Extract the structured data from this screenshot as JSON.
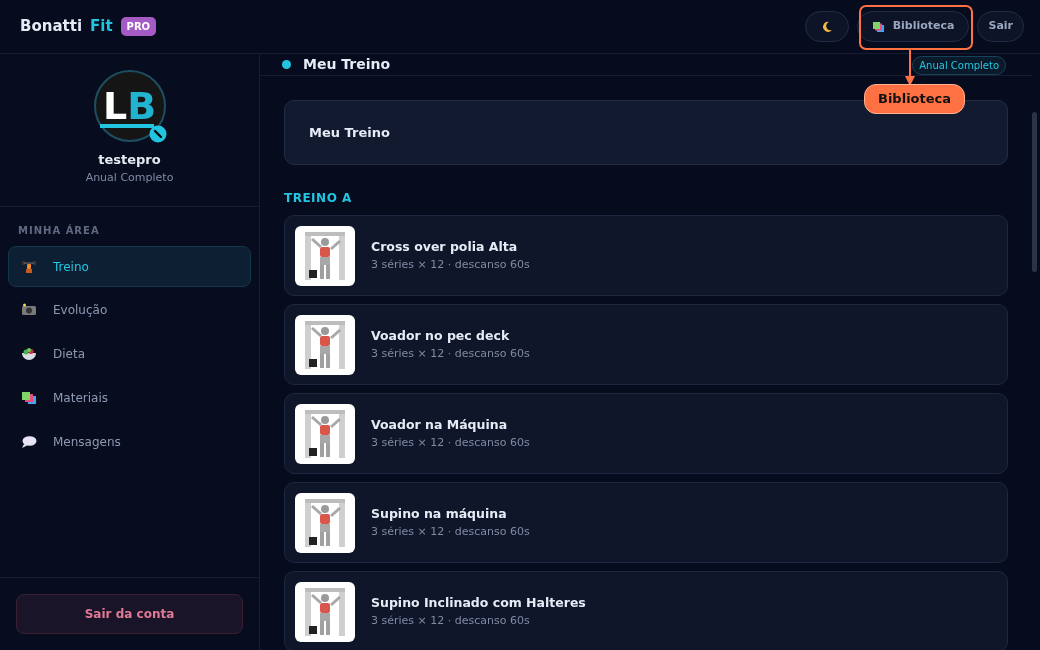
{
  "header": {
    "brand": "Bonatti",
    "brand_accent": "Fit",
    "badge": "PRO",
    "buttons": [
      {
        "kind": "theme"
      },
      {
        "kind": "library",
        "label": "Biblioteca"
      },
      {
        "kind": "logout",
        "label": "Sair"
      }
    ]
  },
  "callout": {
    "label": "Biblioteca"
  },
  "profile": {
    "avatar": {
      "first": "L",
      "second": "B"
    },
    "name": "testepro",
    "plan": "Anual Completo"
  },
  "sidebar": {
    "section": "MINHA ÁREA",
    "items": [
      {
        "kind": "dumbbell",
        "label": "Treino",
        "selected": true
      },
      {
        "kind": "camera",
        "label": "Evolução",
        "selected": false
      },
      {
        "kind": "salad",
        "label": "Dieta",
        "selected": false
      },
      {
        "kind": "materials",
        "label": "Materiais",
        "selected": false
      },
      {
        "kind": "chat",
        "label": "Mensagens",
        "selected": false
      }
    ],
    "logout": "Sair da conta"
  },
  "main": {
    "title": "Meu Treino",
    "plan_badge": "Anual Completo",
    "card_title": "Meu Treino",
    "section": "TREINO A",
    "exercises": [
      {
        "name": "Cross over polia Alta",
        "detail": "3 séries × 12 · descanso 60s",
        "kind": "picture"
      },
      {
        "name": "Voador no pec deck",
        "detail": "3 séries × 12 · descanso 60s",
        "kind": "picture"
      },
      {
        "name": "Voador na Máquina",
        "detail": "3 séries × 12 · descanso 60s",
        "kind": "picture"
      },
      {
        "name": "Supino na máquina",
        "detail": "3 séries × 12 · descanso 60s",
        "kind": "picture"
      },
      {
        "name": "Supino Inclinado com Halteres",
        "detail": "3 séries × 12 · descanso 60s",
        "kind": "picture"
      }
    ]
  }
}
